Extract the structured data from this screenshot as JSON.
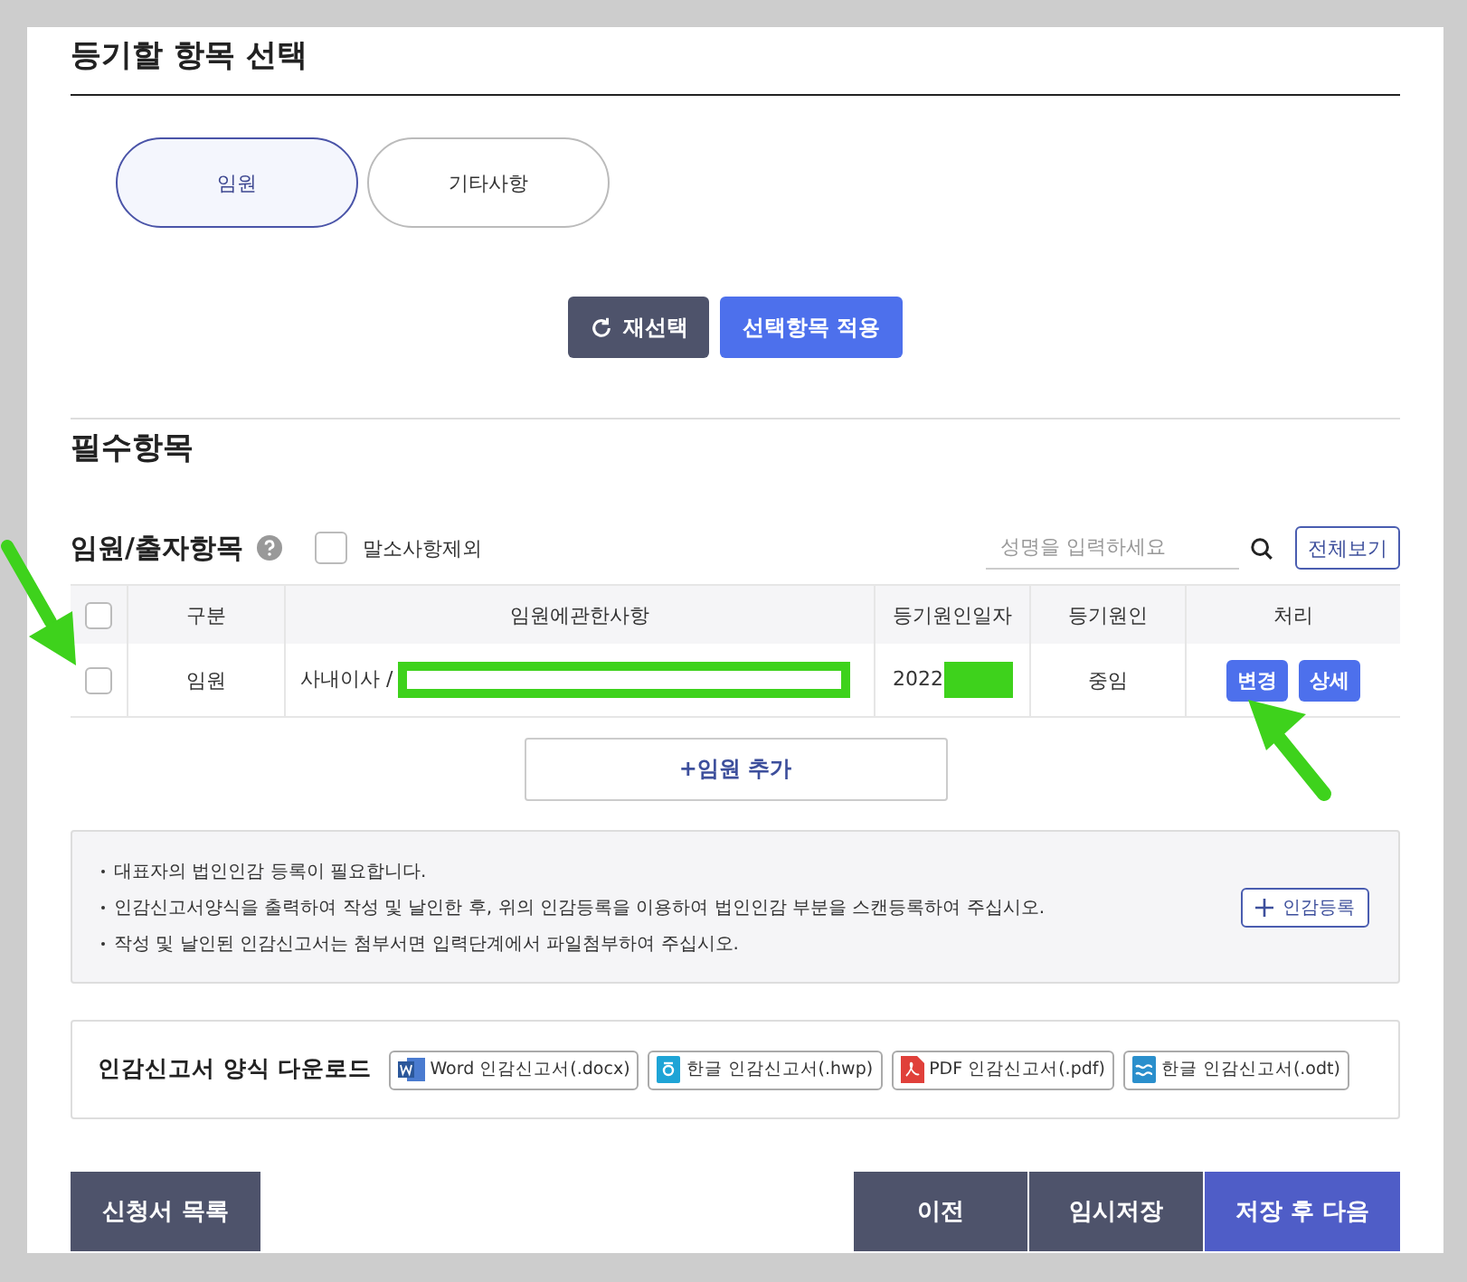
{
  "section_title": "등기할 항목 선택",
  "category_tabs": [
    {
      "label": "임원",
      "selected": true
    },
    {
      "label": "기타사항",
      "selected": false
    }
  ],
  "action_buttons": [
    {
      "label": "재선택",
      "kind": "reset"
    },
    {
      "label": "선택항목 적용",
      "kind": "apply"
    }
  ],
  "required_title": "필수항목",
  "officers": {
    "title": "임원/출자항목",
    "exclude_canceled": {
      "label": "말소사항제외",
      "checked": false
    },
    "search": {
      "placeholder": "성명을 입력하세요"
    },
    "view_all": "전체보기",
    "all_selected": false,
    "columns": [
      "구분",
      "임원에관한사항",
      "등기원인일자",
      "등기원인",
      "처리"
    ],
    "rows": [
      {
        "selected": false,
        "type": "임원",
        "details": "사내이사 /",
        "date": "2022",
        "cause": "중임",
        "actions": [
          "변경",
          "상세"
        ]
      }
    ],
    "add_button": "+임원 추가"
  },
  "notice": {
    "lines": [
      "대표자의 법인인감 등록이 필요합니다.",
      "인감신고서양식을 출력하여 작성 및 날인한 후, 위의 인감등록을 이용하여 법인인감 부분을 스캔등록하여 주십시오.",
      "작성 및 날인된 인감신고서는 첨부서면 입력단계에서 파일첨부하여 주십시오."
    ],
    "button": "인감등록"
  },
  "downloads": {
    "title": "인감신고서 양식 다운로드",
    "files": [
      {
        "label": "Word 인감신고서(.docx)",
        "kind": "word"
      },
      {
        "label": "한글 인감신고서(.hwp)",
        "kind": "hwp"
      },
      {
        "label": "PDF 인감신고서(.pdf)",
        "kind": "pdf"
      },
      {
        "label": "한글 인감신고서(.odt)",
        "kind": "odt"
      }
    ]
  },
  "footer": {
    "list_button": "신청서 목록",
    "buttons": [
      {
        "label": "이전",
        "kind": "secondary"
      },
      {
        "label": "임시저장",
        "kind": "secondary"
      },
      {
        "label": "저장 후 다음",
        "kind": "primary"
      }
    ]
  }
}
